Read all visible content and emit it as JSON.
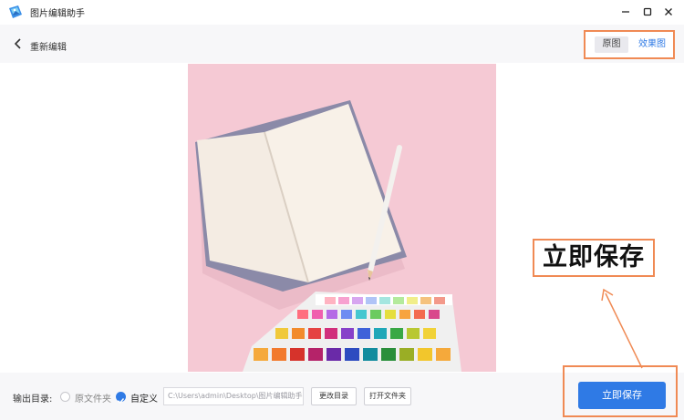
{
  "window": {
    "title": "图片编辑助手",
    "controls": [
      "minimize",
      "maximize",
      "close"
    ]
  },
  "header": {
    "back_label": "重新编辑",
    "toggle": {
      "original_label": "原图",
      "effect_label": "效果图",
      "active": "effect"
    }
  },
  "callout": {
    "text": "立即保存"
  },
  "bottom": {
    "output_label": "输出目录:",
    "option_source": "原文件夹",
    "option_custom": "自定义",
    "selected_option": "custom",
    "path_value": "C:\\Users\\admin\\Desktop\\图片编辑助手",
    "change_dir_label": "更改目录",
    "open_folder_label": "打开文件夹",
    "save_label": "立即保存"
  },
  "colors": {
    "accent": "#2f7ae5",
    "highlight": "#f08a54",
    "photo_bg": "#f5c9d4"
  }
}
